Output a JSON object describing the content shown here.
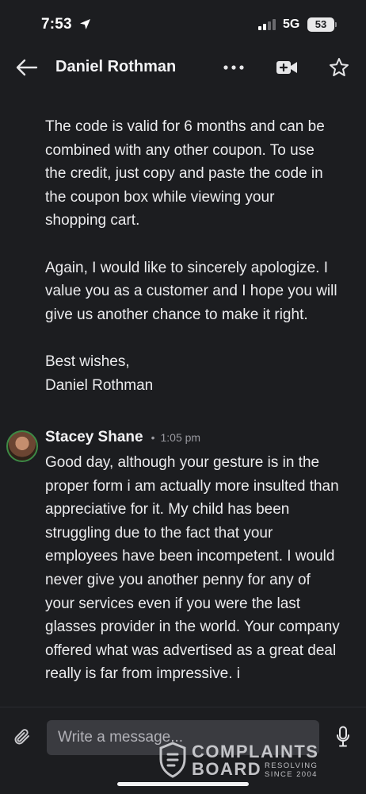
{
  "status_bar": {
    "time": "7:53",
    "network": "5G",
    "battery": "53"
  },
  "header": {
    "contact_name": "Daniel Rothman",
    "icons": [
      "back-arrow-icon",
      "more-dots-icon",
      "video-call-icon",
      "star-icon"
    ]
  },
  "thread": {
    "continued_message": {
      "paragraphs": [
        "The code is valid for 6 months and can be combined with any other coupon. To use the credit, just copy and paste the code in the coupon box while viewing your shopping cart.",
        "Again, I would like to sincerely apologize.  I value you as a customer and I hope you will give us another chance to make it right."
      ],
      "signoff": "Best wishes,",
      "signature": "Daniel Rothman"
    },
    "reply": {
      "author": "Stacey Shane",
      "separator": "•",
      "time": "1:05 pm",
      "text": "Good day, although your gesture is in the proper form i am actually more insulted than appreciative for it. My child has been struggling due to the fact that your employees have been incompetent. I would never give you another penny for any of your services even if you were the last glasses provider in the world. Your  company offered what was advertised as a great deal really is far from impressive. i"
    }
  },
  "composer": {
    "placeholder": "Write a message...",
    "icons": [
      "paperclip-icon",
      "microphone-icon"
    ]
  },
  "watermark": {
    "line1": "COMPLAINTS",
    "line2": "BOARD",
    "tag1": "RESOLVING",
    "tag2": "SINCE 2004"
  },
  "colors": {
    "background": "#1c1d20",
    "text": "#ececee",
    "input_bg": "#3a3b40",
    "avatar_ring": "#3d8a45"
  }
}
